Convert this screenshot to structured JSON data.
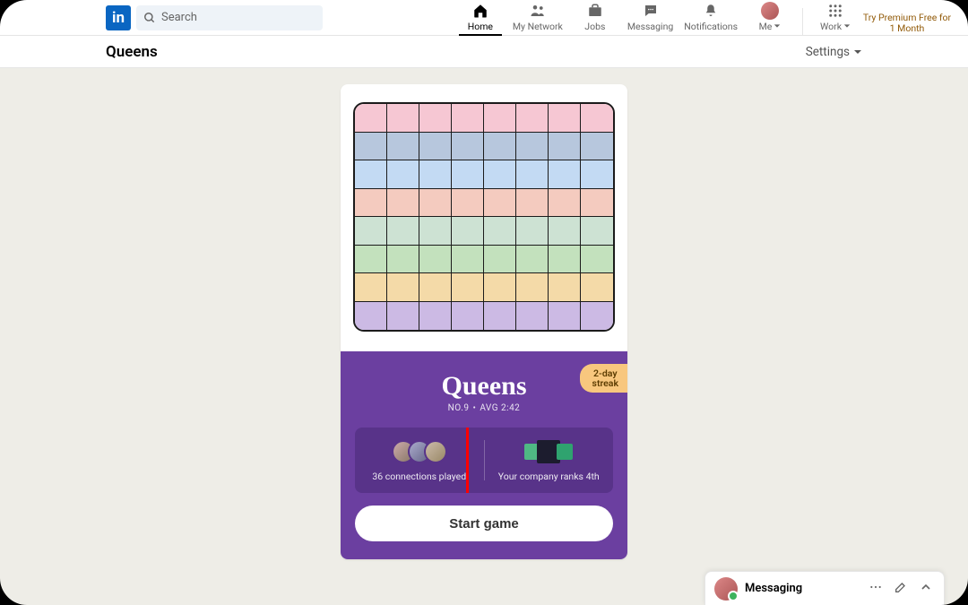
{
  "nav": {
    "search_placeholder": "Search",
    "items": {
      "home": "Home",
      "network": "My Network",
      "jobs": "Jobs",
      "messaging": "Messaging",
      "notifications": "Notifications",
      "me": "Me",
      "work": "Work"
    },
    "premium": "Try Premium Free for 1 Month"
  },
  "subheader": {
    "title": "Queens",
    "settings": "Settings"
  },
  "game": {
    "title": "Queens",
    "number_label": "NO.9",
    "avg_label": "AVG 2:42",
    "streak_line1": "2-day",
    "streak_line2": "streak",
    "connections_played": "36 connections played",
    "company_rank": "Your company ranks 4th",
    "start_button": "Start game",
    "board_row_colors": [
      "pink",
      "blue1",
      "blue2",
      "peach",
      "mint",
      "green",
      "orange",
      "lilac"
    ]
  },
  "messaging": {
    "title": "Messaging"
  },
  "colors": {
    "pink": "#f6c7d3",
    "blue1": "#b7c7dd",
    "blue2": "#c3daf3",
    "peach": "#f4cbbf",
    "mint": "#cde2d3",
    "green": "#c3e1bd",
    "orange": "#f4daa8",
    "lilac": "#ccbae4"
  }
}
